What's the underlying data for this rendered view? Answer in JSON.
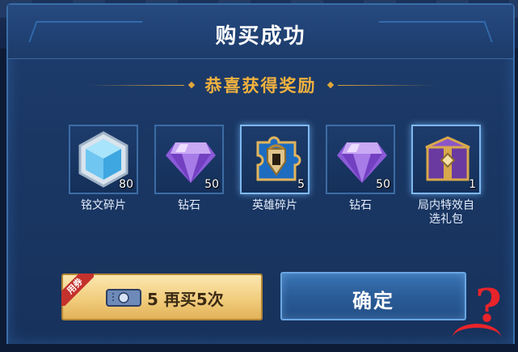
{
  "dialog": {
    "title": "购买成功",
    "subtitle": "恭喜获得奖励"
  },
  "rewards": [
    {
      "name": "铭文碎片",
      "count": "80",
      "icon": "inscription-fragment-icon"
    },
    {
      "name": "钻石",
      "count": "50",
      "icon": "diamond-icon"
    },
    {
      "name": "英雄碎片",
      "count": "5",
      "icon": "hero-fragment-icon"
    },
    {
      "name": "钻石",
      "count": "50",
      "icon": "diamond-icon"
    },
    {
      "name": "局内特效自选礼包",
      "count": "1",
      "icon": "effect-gift-box-icon"
    }
  ],
  "buttons": {
    "buy_again_badge": "用券",
    "buy_again_label": "5 再买5次",
    "confirm_label": "确定"
  },
  "colors": {
    "subtitle": "#f2b23e",
    "dialog_border": "#3a6ea8",
    "confirm_button": "#2a5c98",
    "buy_button": "#f1cd7d"
  }
}
